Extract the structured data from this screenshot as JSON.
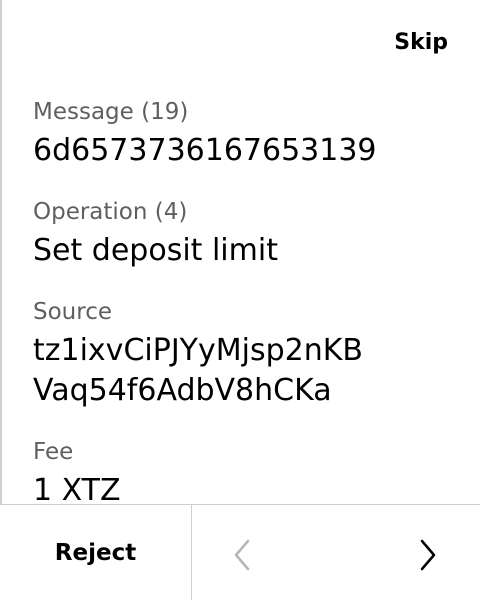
{
  "header": {
    "skip_label": "Skip"
  },
  "fields": [
    {
      "label": "Message (19)",
      "value": "6d6573736167653139"
    },
    {
      "label": "Operation (4)",
      "value": "Set deposit limit"
    },
    {
      "label": "Source",
      "value": "tz1ixvCiPJYyMjsp2nKB\nVaq54f6AdbV8hCKa"
    },
    {
      "label": "Fee",
      "value": "1 XTZ"
    }
  ],
  "footer": {
    "reject_label": "Reject",
    "prev_icon": "chevron-left-icon",
    "next_icon": "chevron-right-icon"
  },
  "colors": {
    "divider": "#cfcfcf",
    "label": "#5f5f5f",
    "text": "#000000",
    "disabled_icon": "#b5b5b5"
  }
}
